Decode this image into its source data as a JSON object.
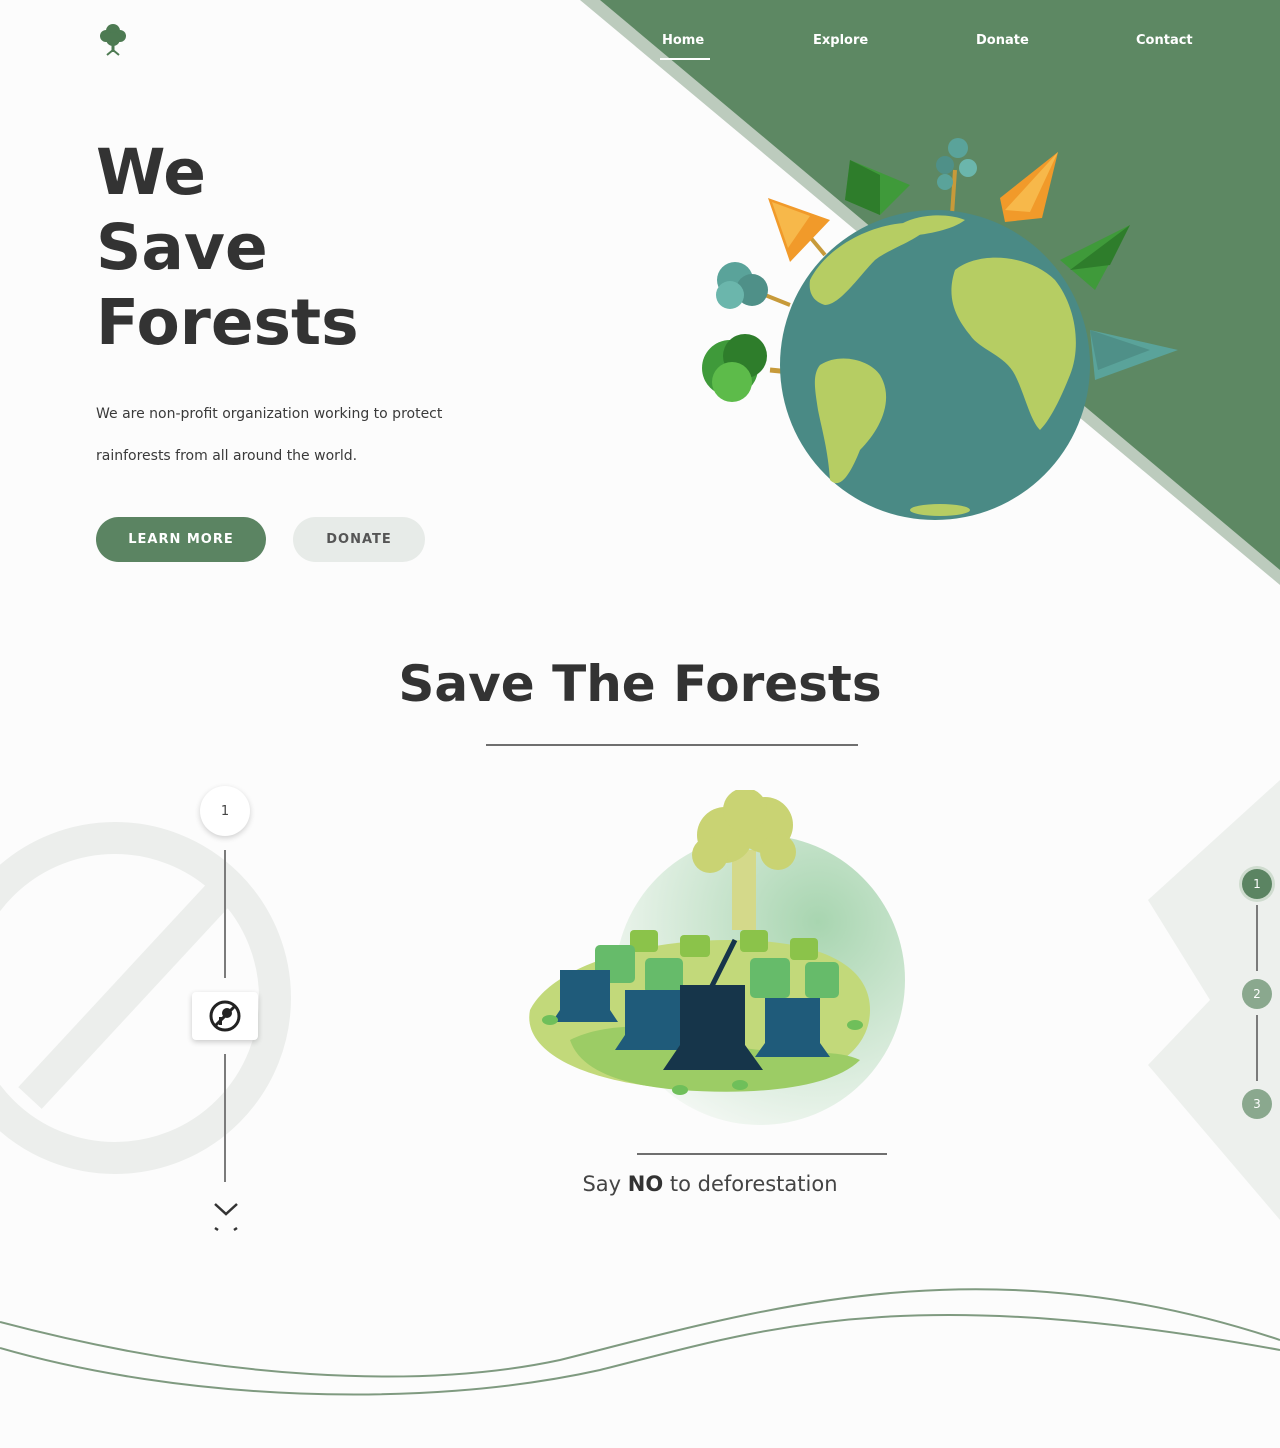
{
  "brand": {
    "logo_icon": "tree-icon"
  },
  "nav": {
    "items": [
      {
        "label": "Home"
      },
      {
        "label": "Explore"
      },
      {
        "label": "Donate"
      },
      {
        "label": "Contact"
      }
    ]
  },
  "hero": {
    "title_lines": [
      "We",
      "Save",
      "Forests"
    ],
    "desc_line1": "We are non-profit organization working to protect",
    "desc_line2": "rainforests from all around the world.",
    "primary_button": "LEARN MORE",
    "secondary_button": "DONATE",
    "illustration": "earth-with-trees-illustration"
  },
  "section": {
    "title": "Save The Forests",
    "step_number": "1",
    "step_icon": "no-deforestation-icon",
    "scroll_icon": "chevron-down-icon",
    "illustration": "cut-tree-stumps-illustration",
    "caption_pre": "Say ",
    "caption_bold": "NO",
    "caption_post": " to deforestation",
    "pager": [
      "1",
      "2",
      "3"
    ],
    "active_page": "1"
  },
  "colors": {
    "accent": "#5b8462",
    "accent_light": "#8aa88e",
    "bg": "#fcfcfc"
  }
}
